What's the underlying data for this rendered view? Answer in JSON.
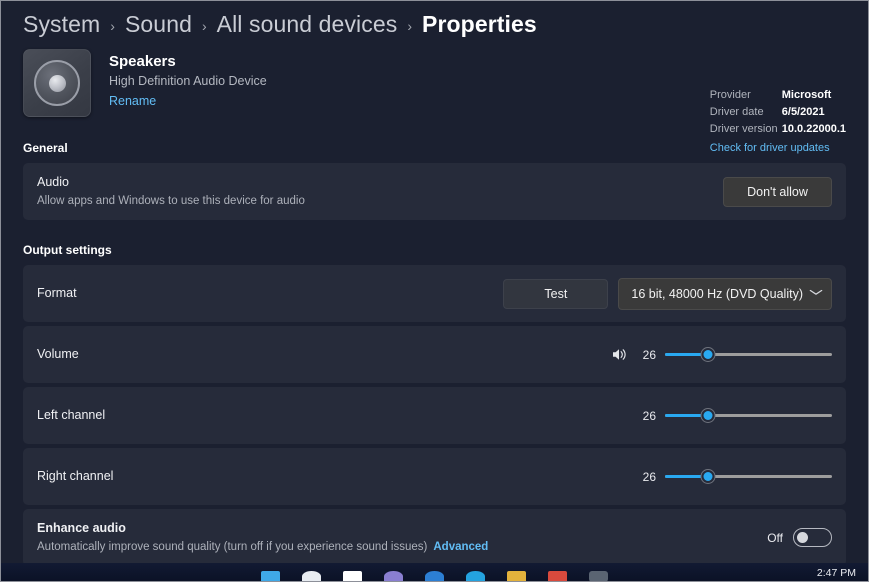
{
  "breadcrumb": {
    "separator": "›",
    "items": [
      {
        "label": "System",
        "current": false
      },
      {
        "label": "Sound",
        "current": false
      },
      {
        "label": "All sound devices",
        "current": false
      },
      {
        "label": "Properties",
        "current": true
      }
    ]
  },
  "device": {
    "icon": "speaker-icon",
    "name": "Speakers",
    "description": "High Definition Audio Device",
    "rename_link": "Rename"
  },
  "driver": {
    "provider_label": "Provider",
    "provider_value": "Microsoft",
    "date_label": "Driver date",
    "date_value": "6/5/2021",
    "version_label": "Driver version",
    "version_value": "10.0.22000.1",
    "update_link": "Check for driver updates"
  },
  "general": {
    "section_title": "General",
    "audio": {
      "title": "Audio",
      "subtitle": "Allow apps and Windows to use this device for audio",
      "button_label": "Don't allow"
    }
  },
  "output_settings": {
    "section_title": "Output settings",
    "format": {
      "title": "Format",
      "test_button": "Test",
      "selected_option": "16 bit, 48000 Hz (DVD Quality)",
      "chevron": "⌄"
    },
    "volume": {
      "title": "Volume",
      "icon": "speaker-volume-icon",
      "value": 26,
      "min": 0,
      "max": 100
    },
    "left_channel": {
      "title": "Left channel",
      "value": 26,
      "min": 0,
      "max": 100
    },
    "right_channel": {
      "title": "Right channel",
      "value": 26,
      "min": 0,
      "max": 100
    },
    "enhance_audio": {
      "title": "Enhance audio",
      "subtitle": "Automatically improve sound quality (turn off if you experience sound issues)",
      "advanced_link": "Advanced",
      "state_label": "Off",
      "enabled": false
    }
  },
  "taskbar": {
    "clock": "2:47 PM",
    "icons": [
      {
        "name": "start-icon",
        "color": "#3fa9e8"
      },
      {
        "name": "search-icon",
        "color": "#e9edf2"
      },
      {
        "name": "widgets-icon",
        "color": "#ffffff"
      },
      {
        "name": "teams-icon",
        "color": "#8a7fd1"
      },
      {
        "name": "explorer-icon",
        "color": "#2c7fd4"
      },
      {
        "name": "store-icon",
        "color": "#24a3e0"
      },
      {
        "name": "folder-icon",
        "color": "#e3b23c"
      },
      {
        "name": "paint-icon",
        "color": "#d94a3d"
      },
      {
        "name": "settings-icon",
        "color": "#5a6472"
      }
    ]
  },
  "colors": {
    "accent": "#29a9f1",
    "link": "#62bdf5",
    "page_background": "#1b2030",
    "card_background": "#262b3a"
  }
}
